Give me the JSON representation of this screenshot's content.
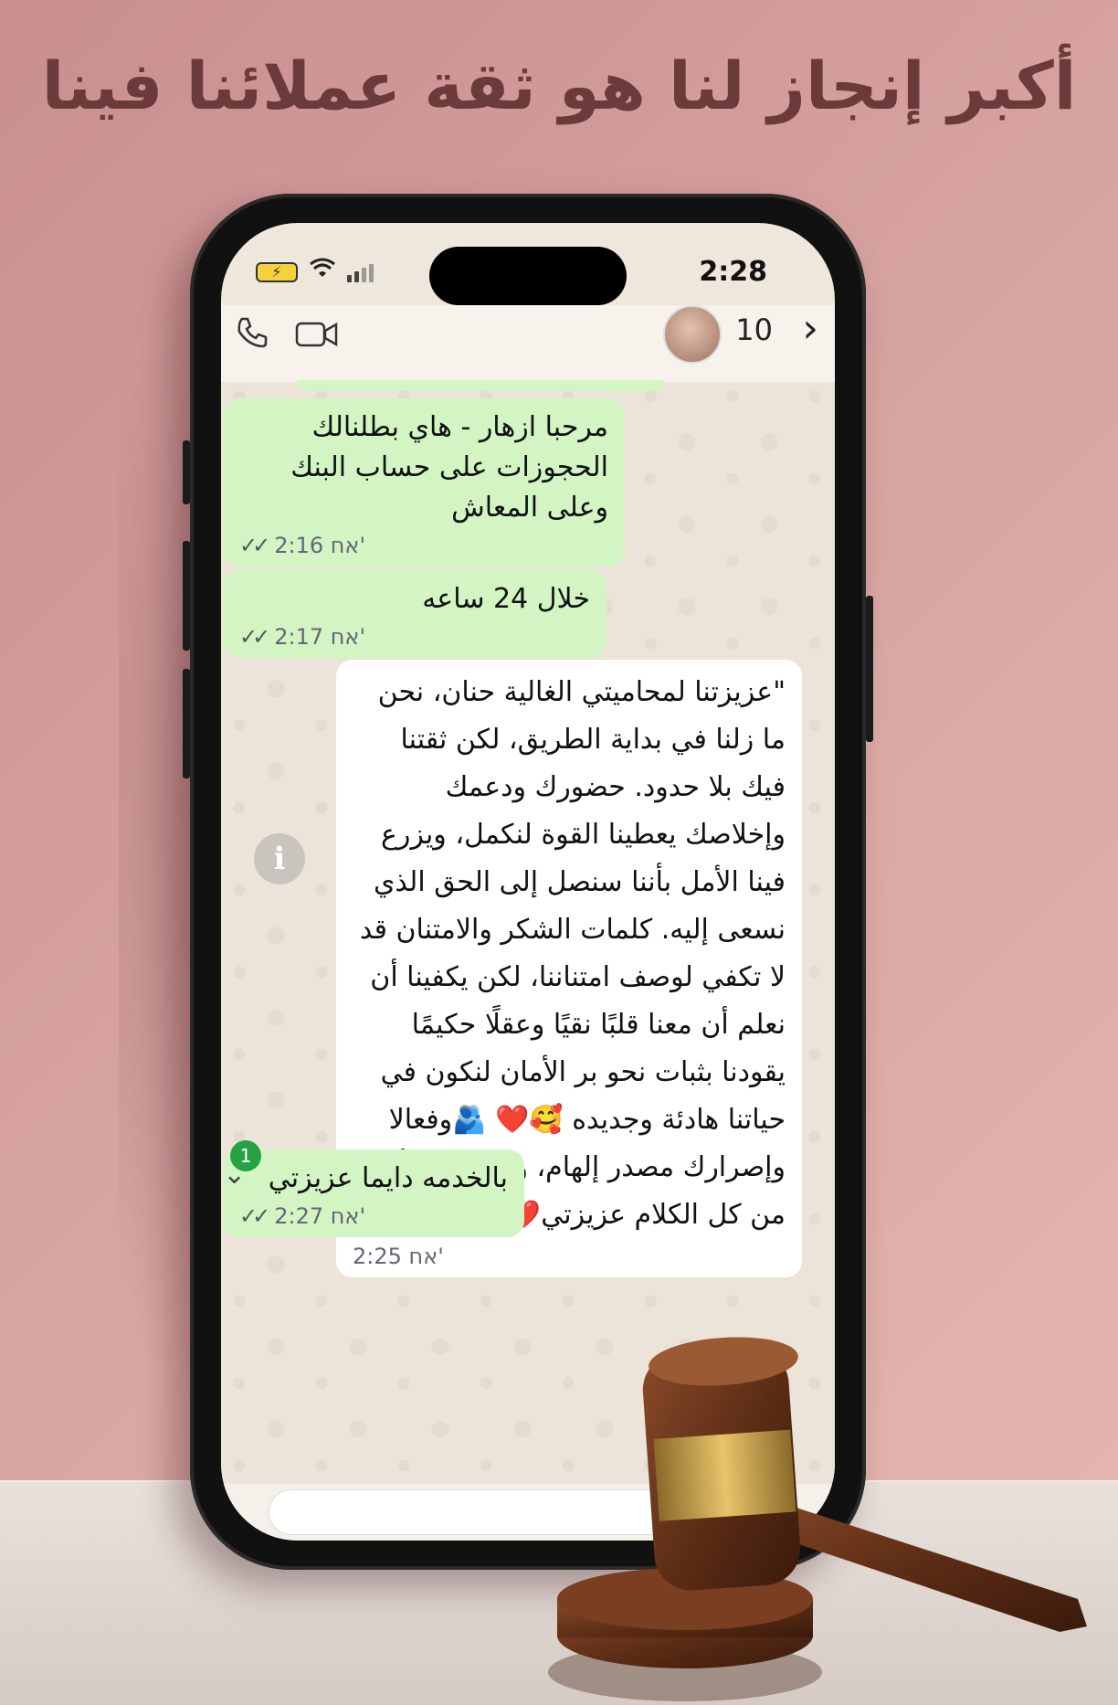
{
  "headline": "أكبر إنجاز لنا هو ثقة عملائنا فينا",
  "status": {
    "time": "2:28"
  },
  "chat_header": {
    "count": "10"
  },
  "messages": [
    {
      "direction": "out",
      "text": "مرحبا ازهار - هاي بطلنالك الحجوزات على حساب البنك وعلى المعاش",
      "time": "2:16 אח'"
    },
    {
      "direction": "out",
      "text": "خلال 24 ساعه",
      "time": "2:17 אח'"
    },
    {
      "direction": "in",
      "text": "\"عزيزتنا  لمحاميتي الغالية حنان، نحن ما زلنا في بداية الطريق، لكن ثقتنا فيك بلا حدود. حضورك ودعمك وإخلاصك يعطينا القوة لنكمل، ويزرع فينا الأمل بأننا سنصل إلى الحق الذي نسعى إليه. كلمات الشكر والامتنان قد لا تكفي لوصف امتناننا، لكن يكفينا أن نعلم أن معنا قلبًا نقيًا وعقلًا حكيمًا يقودنا بثبات نحو بر الأمان لنكون في حياتنا هادئة وجديده 🥰❤️ 🫂وفعالا وإصرارك مصدر إلهام، وثقتنا فيك أكبر من كل الكلام عزيزتي❤️🥰",
      "time": "2:25 אח'"
    },
    {
      "direction": "out",
      "text": "بالخدمه دايما عزيزتي",
      "time": "2:27 אח'"
    }
  ],
  "unread_badge": "1",
  "info_icon": "i",
  "icons": [
    "phone-icon",
    "video-icon",
    "chevron-right-icon",
    "info-icon",
    "chevron-down-icon",
    "wifi-icon",
    "battery-icon",
    "signal-icon"
  ],
  "colors": {
    "background": "#d7a3a1",
    "outgoing_bubble": "#d3f5c4",
    "incoming_bubble": "#ffffff",
    "headline": "#6b3a3a"
  }
}
